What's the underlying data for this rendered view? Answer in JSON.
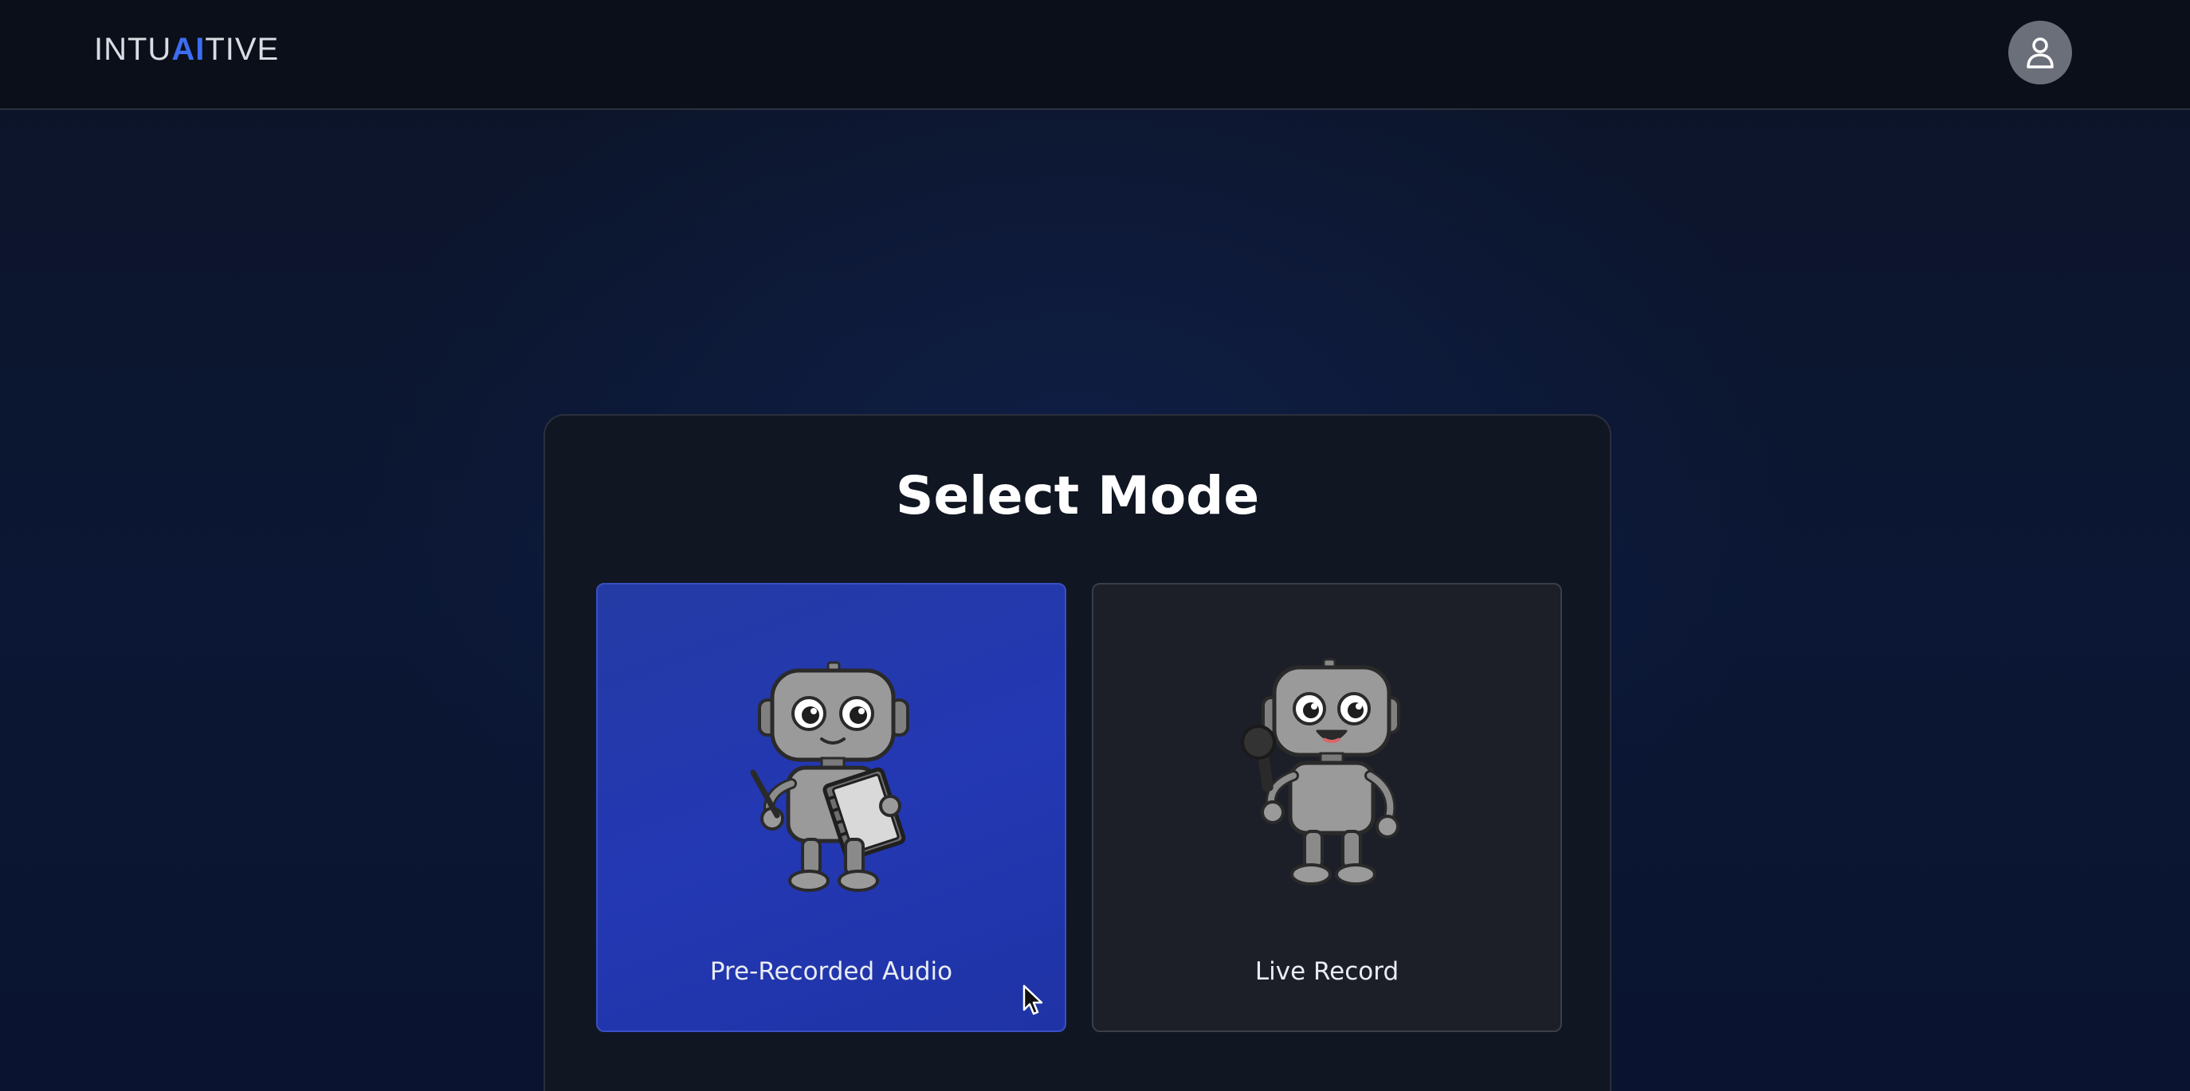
{
  "header": {
    "logo_prefix": "INTU",
    "logo_accent": "AI",
    "logo_suffix": "TIVE",
    "user_icon": "user-icon"
  },
  "main": {
    "title": "Select Mode",
    "modes": [
      {
        "label": "Pre-Recorded Audio",
        "icon": "robot-notebook-icon",
        "selected": true
      },
      {
        "label": "Live Record",
        "icon": "robot-microphone-icon",
        "selected": false
      }
    ]
  },
  "colors": {
    "accent": "#3c6df0",
    "selected_card": "#2338b3",
    "card_bg": "#1c1f28",
    "background": "#0b1734"
  }
}
